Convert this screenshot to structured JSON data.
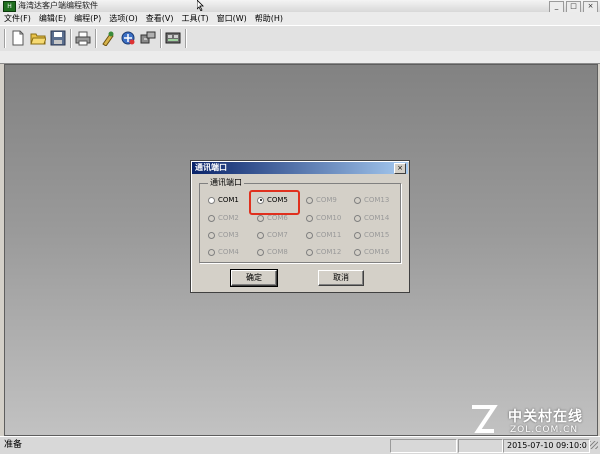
{
  "window": {
    "title": "海湾达客户端编程软件",
    "app_icon_label": "H",
    "min_button": "_",
    "max_button": "□",
    "close_button": "×"
  },
  "menu": {
    "items": [
      "文件(F)",
      "编辑(E)",
      "编程(P)",
      "选项(O)",
      "查看(V)",
      "工具(T)",
      "窗口(W)",
      "帮助(H)"
    ]
  },
  "toolbar": {
    "icons": [
      "new-file-icon",
      "open-folder-icon",
      "save-icon",
      "print-icon",
      "program-icon",
      "communication-icon",
      "connect-icon",
      "device-icon"
    ]
  },
  "dialog": {
    "title": "通讯端口",
    "close_button": "×",
    "group_label": "通讯端口",
    "ports": [
      {
        "label": "COM1",
        "enabled": true,
        "checked": false
      },
      {
        "label": "COM5",
        "enabled": true,
        "checked": true
      },
      {
        "label": "COM9",
        "enabled": false,
        "checked": false
      },
      {
        "label": "COM13",
        "enabled": false,
        "checked": false
      },
      {
        "label": "COM2",
        "enabled": false,
        "checked": false
      },
      {
        "label": "COM6",
        "enabled": false,
        "checked": false
      },
      {
        "label": "COM10",
        "enabled": false,
        "checked": false
      },
      {
        "label": "COM14",
        "enabled": false,
        "checked": false
      },
      {
        "label": "COM3",
        "enabled": false,
        "checked": false
      },
      {
        "label": "COM7",
        "enabled": false,
        "checked": false
      },
      {
        "label": "COM11",
        "enabled": false,
        "checked": false
      },
      {
        "label": "COM15",
        "enabled": false,
        "checked": false
      },
      {
        "label": "COM4",
        "enabled": false,
        "checked": false
      },
      {
        "label": "COM8",
        "enabled": false,
        "checked": false
      },
      {
        "label": "COM12",
        "enabled": false,
        "checked": false
      },
      {
        "label": "COM16",
        "enabled": false,
        "checked": false
      }
    ],
    "ok_label": "确定",
    "cancel_label": "取消",
    "highlight_color": "#e0301e"
  },
  "status": {
    "text": "准备",
    "datetime": "2015-07-10  09:10:0"
  },
  "watermark": {
    "cn": "中关村在线",
    "en": "ZOL.COM.CN"
  },
  "colors": {
    "dialog_title_start": "#0a246a",
    "dialog_title_end": "#a6caf0",
    "workspace": "#9a9a9a"
  }
}
